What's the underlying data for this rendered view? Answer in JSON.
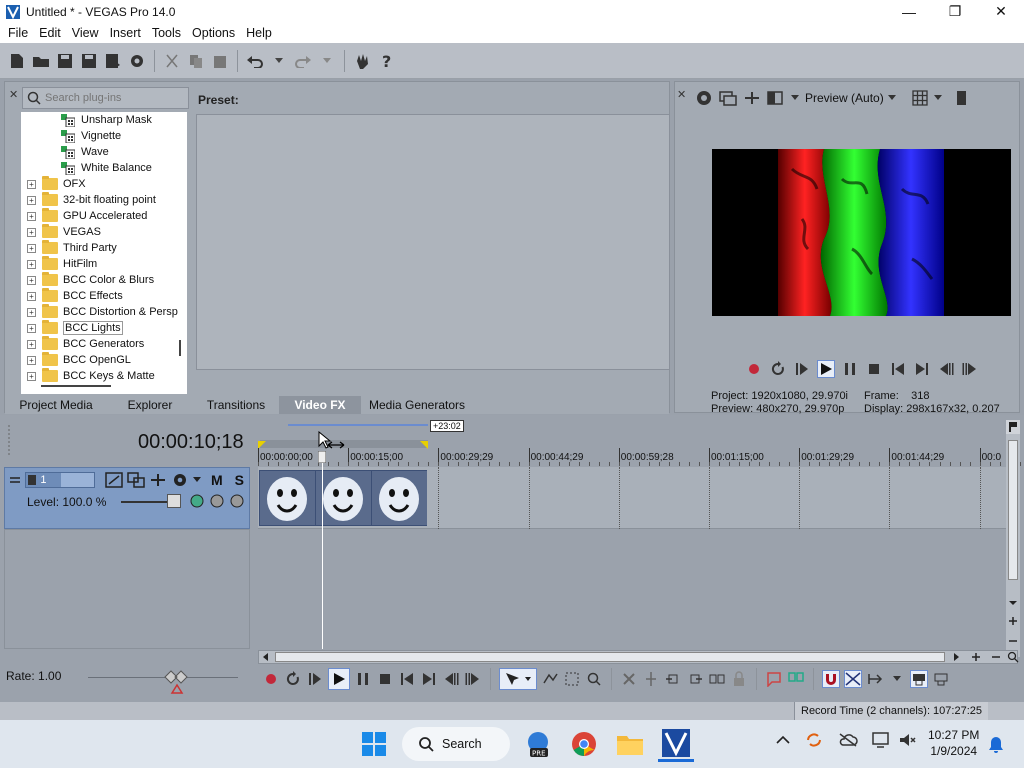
{
  "window": {
    "title": "Untitled * - VEGAS Pro 14.0"
  },
  "menu": [
    "File",
    "Edit",
    "View",
    "Insert",
    "Tools",
    "Options",
    "Help"
  ],
  "plugins": {
    "search_placeholder": "Search plug-ins",
    "preset_label": "Preset:",
    "tree": [
      {
        "label": "Unsharp Mask",
        "type": "fx",
        "indent": 2
      },
      {
        "label": "Vignette",
        "type": "fx",
        "indent": 2
      },
      {
        "label": "Wave",
        "type": "fx",
        "indent": 2
      },
      {
        "label": "White Balance",
        "type": "fx",
        "indent": 2
      },
      {
        "label": "OFX",
        "type": "folder",
        "indent": 1
      },
      {
        "label": "32-bit floating point",
        "type": "folder",
        "indent": 1
      },
      {
        "label": "GPU Accelerated",
        "type": "folder",
        "indent": 1
      },
      {
        "label": "VEGAS",
        "type": "folder",
        "indent": 1
      },
      {
        "label": "Third Party",
        "type": "folder",
        "indent": 1
      },
      {
        "label": "HitFilm",
        "type": "folder",
        "indent": 1
      },
      {
        "label": "BCC Color & Blurs",
        "type": "folder",
        "indent": 1
      },
      {
        "label": "BCC Effects",
        "type": "folder",
        "indent": 1
      },
      {
        "label": "BCC Distortion & Persp",
        "type": "folder",
        "indent": 1
      },
      {
        "label": "BCC Lights",
        "type": "folder",
        "indent": 1,
        "selected": true
      },
      {
        "label": "BCC Generators",
        "type": "folder",
        "indent": 1
      },
      {
        "label": "BCC OpenGL",
        "type": "folder",
        "indent": 1
      },
      {
        "label": "BCC Keys & Matte",
        "type": "folder",
        "indent": 1
      }
    ]
  },
  "tabs": [
    {
      "label": "Project Media",
      "active": false
    },
    {
      "label": "Explorer",
      "active": false
    },
    {
      "label": "Transitions",
      "active": false
    },
    {
      "label": "Video FX",
      "active": true
    },
    {
      "label": "Media Generators",
      "active": false
    }
  ],
  "preview": {
    "mode_label": "Preview (Auto)",
    "project_label": "Project:",
    "project_value": "1920x1080, 29.970i",
    "frame_label": "Frame:",
    "frame_value": "318",
    "preview_label": "Preview:",
    "preview_value": "480x270, 29.970p",
    "display_label": "Display:",
    "display_value": "298x167x32, 0.207"
  },
  "timeline": {
    "timecode": "00:00:10;18",
    "region_label": "+23:02",
    "ticks": [
      "00:00:00;00",
      "00:00:15;00",
      "00:00:29;29",
      "00:00:44;29",
      "00:00:59;28",
      "00:01:15;00",
      "00:01:29;29",
      "00:01:44;29",
      "00:0"
    ],
    "track": {
      "number": "1",
      "level": "Level: 100.0 %",
      "mute": "M",
      "solo": "S"
    },
    "rate": "Rate: 1.00"
  },
  "status": {
    "record_time": "Record Time (2 channels): 107:27:25"
  },
  "taskbar": {
    "search_label": "Search",
    "time": "10:27 PM",
    "date": "1/9/2024",
    "pre_badge": "PRE"
  },
  "colors": {
    "accent": "#6b8ccf",
    "track": "#7f9bc4",
    "panel": "#a3aab3"
  }
}
